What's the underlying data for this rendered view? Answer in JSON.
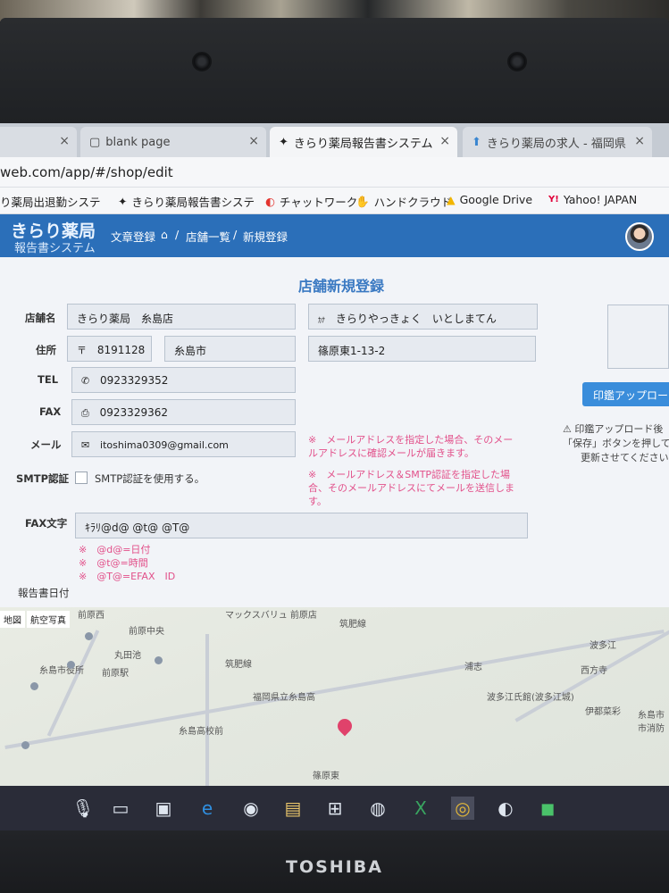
{
  "browser": {
    "tabs": [
      {
        "label": "",
        "close": "×"
      },
      {
        "label": "blank page",
        "close": "×"
      },
      {
        "label": "きらり薬局報告書システム",
        "close": "×"
      },
      {
        "label": "きらり薬局の求人 - 福岡県",
        "close": "×"
      }
    ],
    "url": "web.com/app/#/shop/edit",
    "bookmarks": [
      {
        "label": "り薬局出退勤システ",
        "icon": "bookmark-icon"
      },
      {
        "label": "きらり薬局報告書システ",
        "icon": "star-logo-icon"
      },
      {
        "label": "チャットワーク",
        "icon": "chatwork-icon"
      },
      {
        "label": "ハンドクラウド",
        "icon": "handcloud-icon"
      },
      {
        "label": "Google Drive",
        "icon": "google-drive-icon"
      },
      {
        "label": "Yahoo! JAPAN",
        "icon": "yahoo-icon"
      }
    ]
  },
  "app": {
    "logo_main": "きらり薬局",
    "logo_sub": "報告書システム",
    "nav": {
      "doc": "文章登録",
      "sep1": "/",
      "list": "店舗一覧",
      "sep2": "/",
      "new": "新規登録"
    }
  },
  "form": {
    "title": "店舗新規登録",
    "store_name_label": "店舗名",
    "store_name": "きらり薬局　糸島店",
    "store_kana_icon": "ｶﾅ",
    "store_kana": "きらりやっきょく　いとしまてん",
    "address_label": "住所",
    "postal_mark": "〒",
    "postal": "8191128",
    "city": "糸島市",
    "street": "篠原東1-13-2",
    "tel_label": "TEL",
    "tel": "0923329352",
    "fax_label": "FAX",
    "fax": "0923329362",
    "mail_label": "メール",
    "mail": "itoshima0309@gmail.com",
    "mail_note_1": "※　メールアドレスを指定した場合、そのメー",
    "mail_note_2": "ルアドレスに確認メールが届きます。",
    "smtp_label": "SMTP認証",
    "smtp_checkbox": "SMTP認証を使用する。",
    "smtp_note_1": "※　メールアドレス＆SMTP認証を指定した場",
    "smtp_note_2": "合、そのメールアドレスにてメールを送信しま",
    "smtp_note_3": "す。",
    "fax_text_label": "FAX文字",
    "fax_text": "ｷﾗﾘ@d@ @t@ @T@",
    "fax_hint_1": "※　@d@=日付",
    "fax_hint_2": "※　@t@=時間",
    "fax_hint_3": "※　@T@=EFAX　ID",
    "report_date_label": "報告書日付",
    "stamp_upload_button": "印鑑アップロー",
    "stamp_warn_1": "⚠ 印鑑アップロード後",
    "stamp_warn_2": "「保存」ボタンを押して",
    "stamp_warn_3": "更新させてください"
  },
  "map": {
    "type_map": "地図",
    "type_satellite": "航空写真",
    "labels": [
      "前原西",
      "前原中央",
      "マックスバリュ 前原店",
      "筑肥線",
      "丸田池",
      "糸島市役所",
      "筑肥線",
      "福岡県立糸島高",
      "糸島高校前",
      "篠原東",
      "浦志",
      "波多江",
      "西方寺",
      "波多江氏館(波多江城)",
      "伊都菜彩",
      "糸島市市消防",
      "前原駅"
    ]
  },
  "taskbar": [
    "mic-icon",
    "task-view-icon",
    "media-icon",
    "edge-icon",
    "app-icon",
    "explorer-icon",
    "store-icon",
    "app2-icon",
    "excel-icon",
    "chrome-icon",
    "app3-icon",
    "line-icon"
  ],
  "brand": "TOSHIBA"
}
